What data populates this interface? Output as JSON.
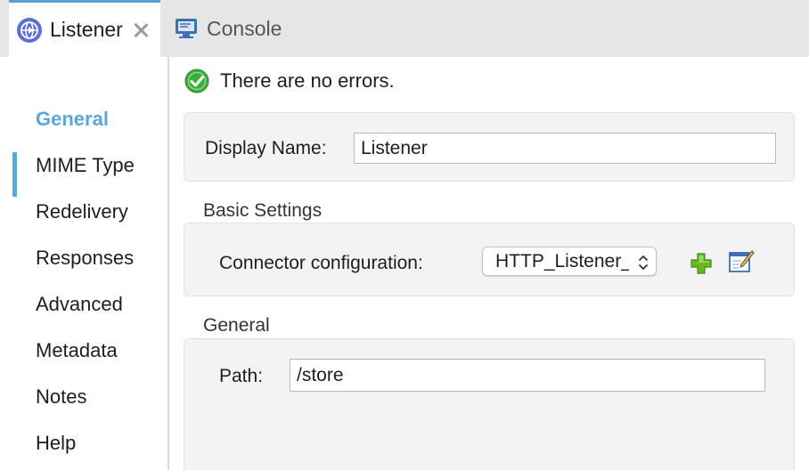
{
  "tabs": {
    "listener": {
      "label": "Listener"
    },
    "console": {
      "label": "Console"
    }
  },
  "sidebar": {
    "items": [
      {
        "label": "General",
        "active": true
      },
      {
        "label": "MIME Type"
      },
      {
        "label": "Redelivery"
      },
      {
        "label": "Responses"
      },
      {
        "label": "Advanced"
      },
      {
        "label": "Metadata"
      },
      {
        "label": "Notes"
      },
      {
        "label": "Help"
      }
    ]
  },
  "status": {
    "text": "There are no errors."
  },
  "display": {
    "label": "Display Name:",
    "value": "Listener"
  },
  "basic_settings": {
    "title": "Basic Settings",
    "connector_label": "Connector configuration:",
    "connector_value": "HTTP_Listener_config"
  },
  "general": {
    "title": "General",
    "path_label": "Path:",
    "path_value": "/store"
  },
  "colors": {
    "accent": "#5aa7d8",
    "success": "#3cae3c",
    "add": "#66bb22"
  },
  "icons": [
    "globe-arrow-icon",
    "close-icon",
    "console-icon",
    "checkmark-icon",
    "add-icon",
    "edit-icon",
    "updown-arrows-icon"
  ]
}
